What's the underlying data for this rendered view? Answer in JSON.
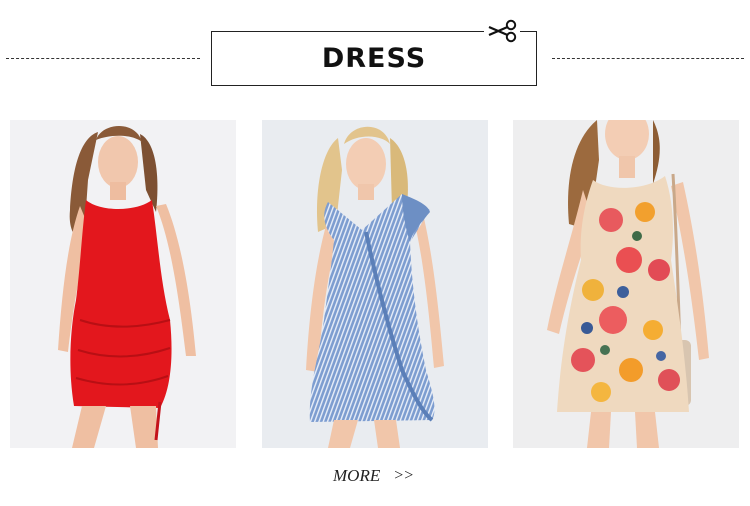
{
  "section": {
    "title": "DRESS",
    "more_label": "MORE",
    "more_arrows": ">>"
  },
  "products": [
    {
      "name": "red-sleeveless-ruched-dress",
      "color": "#e3171d"
    },
    {
      "name": "blue-striped-ruffle-wrap-dress",
      "color": "#6d8fc4"
    },
    {
      "name": "floral-print-sundress",
      "color": "#efd9bf"
    }
  ],
  "icons": {
    "scissors": "scissors-icon"
  }
}
